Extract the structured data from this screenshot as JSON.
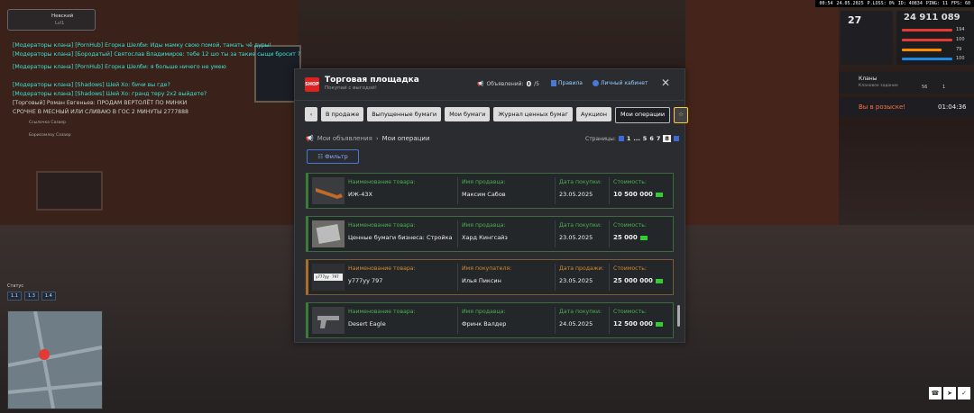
{
  "topbar": {
    "time": "00:54",
    "date": "24.05.2025",
    "ploss": "P.LOSS: 0%",
    "id": "ID: 40834",
    "ping": "PING: 11",
    "fps": "FPS: 60"
  },
  "hud": {
    "level": "27",
    "money": "24 911 089",
    "stats": [
      {
        "value": "194",
        "color": "#e53935"
      },
      {
        "value": "100",
        "color": "#e53935"
      },
      {
        "value": "79",
        "color": "#fb8c00"
      },
      {
        "value": "100",
        "color": "#1e88e5"
      }
    ],
    "clan_label": "Кланы",
    "clan_sub": "Клановое задание",
    "clan_a": "56",
    "clan_b": "1",
    "wanted": "Вы в розыске!",
    "timer": "01:04:36",
    "player_tag": "Невский",
    "player_sub": "Lvl1"
  },
  "chat": [
    {
      "text": "[Модераторы клана] [PornHub] Егорка Шелби: Иды мамку свою помой, тамать чё дуры!",
      "color": "#40e0d0"
    },
    {
      "text": "[Модераторы клана] [Бородатый] Святослав Владимиров: тебе 12 шо ты за такие сыщи бросит ?",
      "color": "#40e0d0"
    },
    {
      "text": "[Модераторы клана] [PornHub] Егорка Шелби: я больше ничего не умею",
      "color": "#40e0d0"
    },
    {
      "text": "[Модераторы клана] [Shadows] Шей Хо: бичи вы где?",
      "color": "#40e0d0"
    },
    {
      "text": "[Модераторы клана] [Shadows] Шей Хо: гранд теру 2x2 выйдете?",
      "color": "#40e0d0"
    },
    {
      "text": "[Торговый] Роман Евгеньев: ПРОДАМ ВЕРТОЛЁТ ПО МИНКИ",
      "color": "#d0d0d0"
    },
    {
      "text": "СРОЧНЕ В МЕСНЫЙ ИЛИ СЛИВАЮ В ГОС 2 МИНУТЫ 2777888",
      "color": "#d0d0d0"
    }
  ],
  "chat_players": [
    {
      "text": "Ссылочка Сазаер"
    },
    {
      "text": "Борисомлоу Сазаер"
    }
  ],
  "status": {
    "label": "Статус",
    "buttons": [
      "1.1",
      "1.3",
      "1.4"
    ]
  },
  "modal": {
    "title": "Торговая площадка",
    "subtitle": "Покупай с выгодой!",
    "logo": "SHOP",
    "ads_label": "Объявлений:",
    "ads_count": "0",
    "ads_total": "/5",
    "rules": "Правила",
    "cabinet": "Личный кабинет",
    "close": "✕",
    "tabs": [
      "В продаже",
      "Выпущенные бумаги",
      "Мои бумаги",
      "Журнал ценных бумаг",
      "Аукцион",
      "Мои операции"
    ],
    "active_tab": "Мои операции",
    "crumb_1": "Мои объявления",
    "crumb_sep": "›",
    "crumb_2": "Мои операции",
    "pages_label": "Страницы:",
    "pages": [
      "1",
      "...",
      "5",
      "6",
      "7",
      "8"
    ],
    "current_page": "8",
    "filter": "Фильтр",
    "rows": [
      {
        "type": "purchase",
        "name_label": "Наименование товара:",
        "name": "ИЖ-43Х",
        "person_label": "Имя продавца:",
        "person": "Максим Сабов",
        "date_label": "Дата покупки:",
        "date": "23.05.2025",
        "price_label": "Стоимость:",
        "price": "10 500 000",
        "thumb": "rifle"
      },
      {
        "type": "purchase",
        "name_label": "Наименование товара:",
        "name": "Ценные бумаги бизнеса: Стройка",
        "person_label": "Имя продавца:",
        "person": "Хард Кингсайз",
        "date_label": "Дата покупки:",
        "date": "23.05.2025",
        "price_label": "Стоимость:",
        "price": "25 000",
        "thumb": "paper"
      },
      {
        "type": "sale",
        "name_label": "Наименование товара:",
        "name": "у777уу 797",
        "person_label": "Имя покупателя:",
        "person": "Илья Пиксин",
        "date_label": "Дата продажи:",
        "date": "23.05.2025",
        "price_label": "Стоимость:",
        "price": "25 000 000",
        "thumb": "plate",
        "plate_text": "у777уу",
        "plate_region": "797"
      },
      {
        "type": "purchase",
        "name_label": "Наименование товара:",
        "name": "Desert Eagle",
        "person_label": "Имя продавца:",
        "person": "Фринк Валдер",
        "date_label": "Дата покупки:",
        "date": "24.05.2025",
        "price_label": "Стоимость:",
        "price": "12 500 000",
        "thumb": "pistol"
      }
    ]
  }
}
